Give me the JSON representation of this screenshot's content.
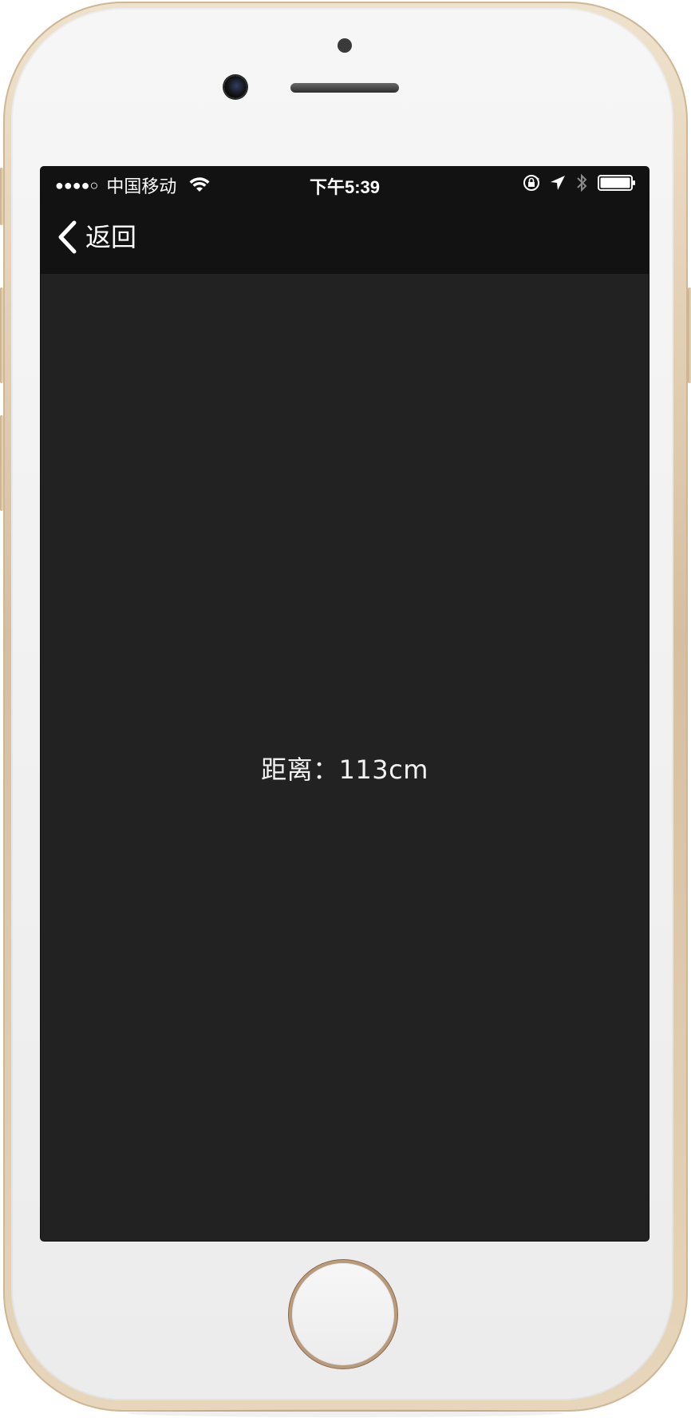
{
  "status_bar": {
    "signal_dots": "●●●●○",
    "carrier": "中国移动",
    "time": "下午5:39",
    "battery_level": 1.0
  },
  "nav": {
    "back_label": "返回"
  },
  "content": {
    "distance_text": "距离：113cm"
  },
  "colors": {
    "screen_background": "#222222",
    "bar_background": "#121212",
    "text": "#ffffff",
    "phone_gold": "#d6bfa0"
  },
  "icons": {
    "back": "chevron-left-icon",
    "wifi": "wifi-icon",
    "rotation_lock": "rotation-lock-icon",
    "location": "location-arrow-icon",
    "bluetooth": "bluetooth-icon",
    "battery": "battery-icon"
  }
}
